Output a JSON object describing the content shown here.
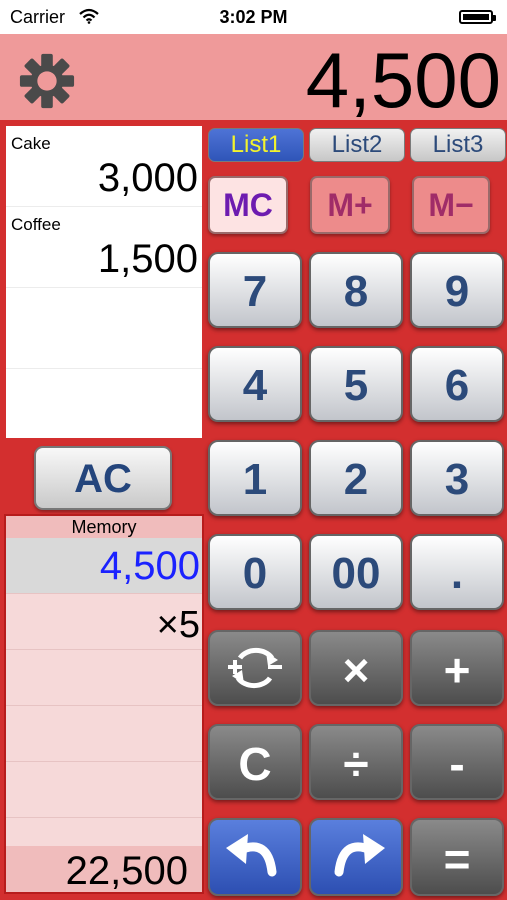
{
  "status_bar": {
    "carrier": "Carrier",
    "time": "3:02 PM"
  },
  "topbar": {
    "settings_icon": "gear-icon",
    "display_value": "4,500"
  },
  "list": {
    "items": [
      {
        "name": "Cake",
        "amount": "3,000"
      },
      {
        "name": "Coffee",
        "amount": "1,500"
      }
    ]
  },
  "ac_label": "AC",
  "memory": {
    "header": "Memory",
    "value": "4,500",
    "multiplier": "×5",
    "total": "22,500"
  },
  "tabs": [
    {
      "label": "List1",
      "active": true
    },
    {
      "label": "List2",
      "active": false
    },
    {
      "label": "List3",
      "active": false
    }
  ],
  "memory_buttons": {
    "mc": "MC",
    "mplus": "M+",
    "mminus": "M−"
  },
  "keys": {
    "seven": "7",
    "eight": "8",
    "nine": "9",
    "four": "4",
    "five": "5",
    "six": "6",
    "one": "1",
    "two": "2",
    "three": "3",
    "zero": "0",
    "double_zero": "00",
    "decimal": ".",
    "multiply": "×",
    "add": "+",
    "clear": "C",
    "divide": "÷",
    "subtract": "-",
    "equals": "="
  },
  "icons": {
    "toggle_sign": "plus-minus-cycle-icon",
    "undo": "undo-arrow-icon",
    "redo": "redo-arrow-icon"
  },
  "colors": {
    "background": "#d32f2f",
    "display_bar": "#ef9a9a",
    "active_tab": "#3a62c9",
    "memory_value": "#1b22ff"
  }
}
